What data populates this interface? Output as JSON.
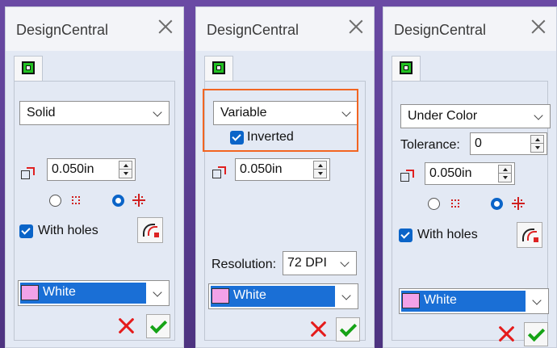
{
  "panels": [
    {
      "title": "DesignCentral",
      "mode": "Solid",
      "offset": "0.050in",
      "with_holes": "With holes",
      "color": "White"
    },
    {
      "title": "DesignCentral",
      "mode": "Variable",
      "inverted": "Inverted",
      "offset": "0.050in",
      "resolution_label": "Resolution:",
      "resolution": "72 DPI",
      "color": "White"
    },
    {
      "title": "DesignCentral",
      "mode": "Under Color",
      "tolerance_label": "Tolerance:",
      "tolerance": "0",
      "offset": "0.050in",
      "with_holes": "With holes",
      "color": "White"
    }
  ],
  "colors": {
    "highlight_box": "#f26522",
    "selection": "#1a6fd6",
    "swatch_white_preview": "#f2a2e8",
    "cancel": "#e51b1b",
    "ok": "#16a316"
  }
}
